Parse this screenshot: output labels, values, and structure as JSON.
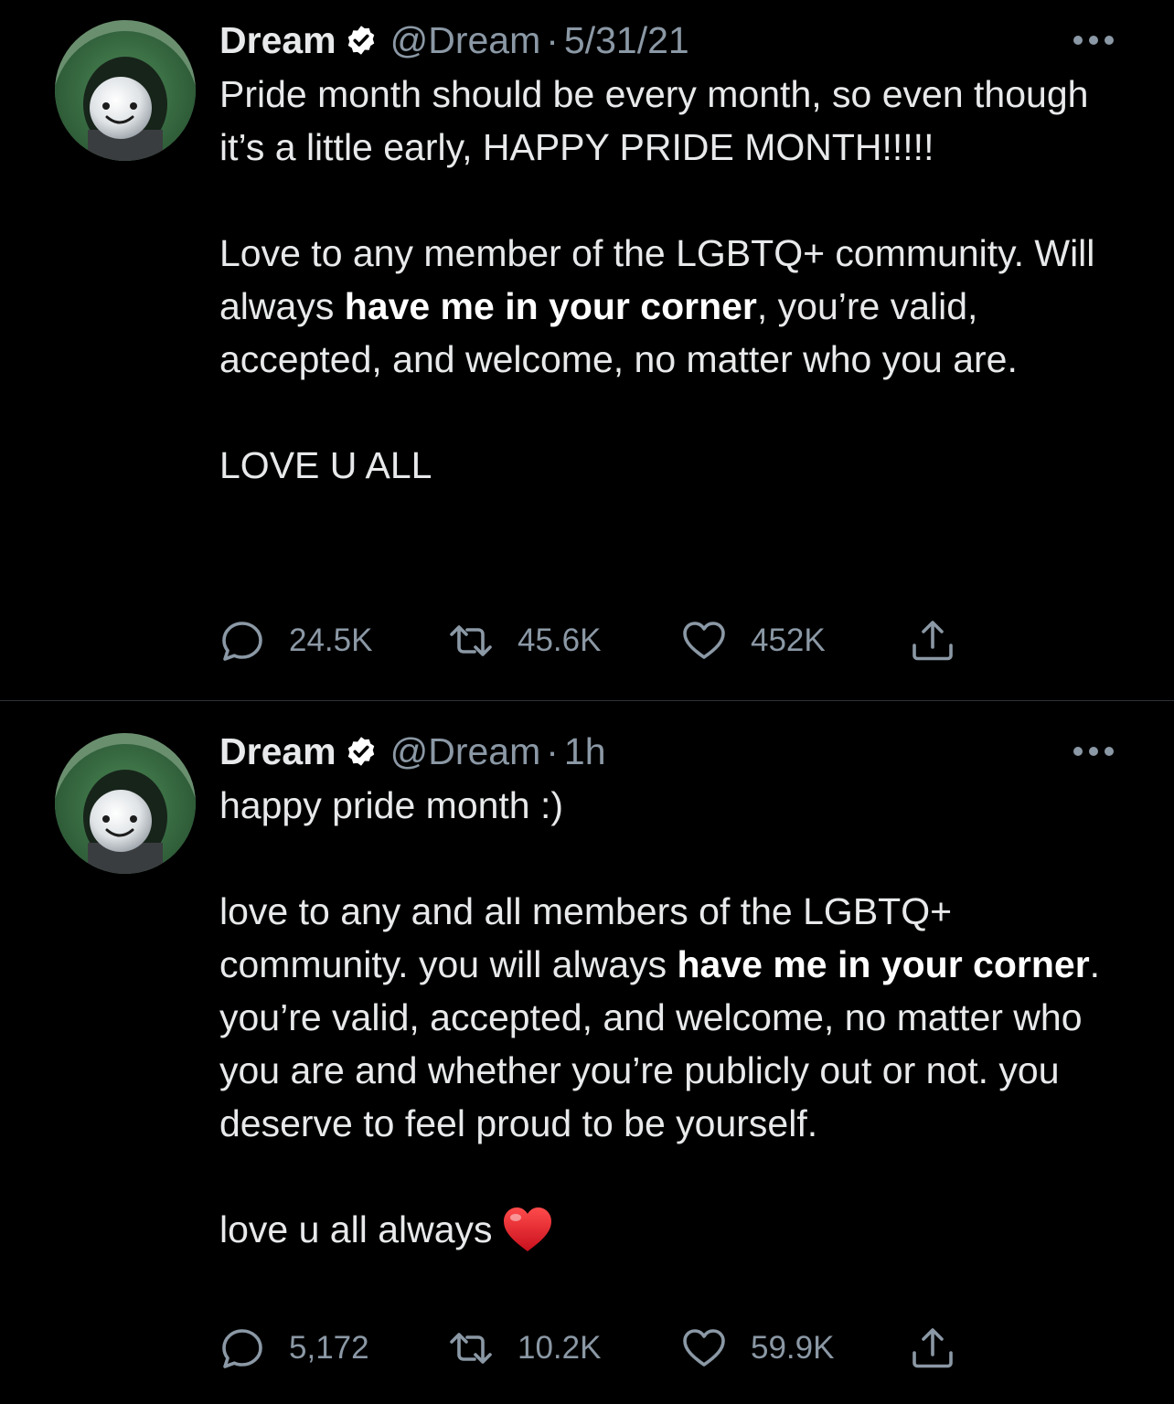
{
  "colors": {
    "background": "#000000",
    "text_primary": "#e7e9ea",
    "text_secondary": "#8b98a5",
    "verified_badge": "#ffffff",
    "divider": "#2f3336",
    "heart_emoji": "#e0212b"
  },
  "tweets": [
    {
      "display_name": "Dream",
      "handle": "@Dream",
      "separator": "·",
      "timestamp": "5/31/21",
      "verified_icon": "verified-badge-icon",
      "body": {
        "p1": "Pride month should be every month, so even though it’s a little early, HAPPY PRIDE MONTH!!!!!",
        "p2_before": "Love to any member of the LGBTQ+ community. Will always ",
        "p2_bold": "have me in your corner",
        "p2_after": ", you’re valid, accepted, and welcome, no matter who you are.",
        "p3": "LOVE U ALL"
      },
      "actions": {
        "replies": "24.5K",
        "retweets": "45.6K",
        "likes": "452K"
      }
    },
    {
      "display_name": "Dream",
      "handle": "@Dream",
      "separator": "·",
      "timestamp": "1h",
      "verified_icon": "verified-badge-icon",
      "body": {
        "p1": "happy pride month :)",
        "p2_before": "love to any and all members of the LGBTQ+ community. you will always ",
        "p2_bold": "have me in your corner",
        "p2_after": ". you’re valid, accepted, and welcome, no matter who you are and whether you’re publicly out or not. you deserve to feel proud to be yourself.",
        "p3": "love u all always",
        "p3_emoji": "red-heart-emoji"
      },
      "actions": {
        "replies": "5,172",
        "retweets": "10.2K",
        "likes": "59.9K"
      }
    }
  ]
}
